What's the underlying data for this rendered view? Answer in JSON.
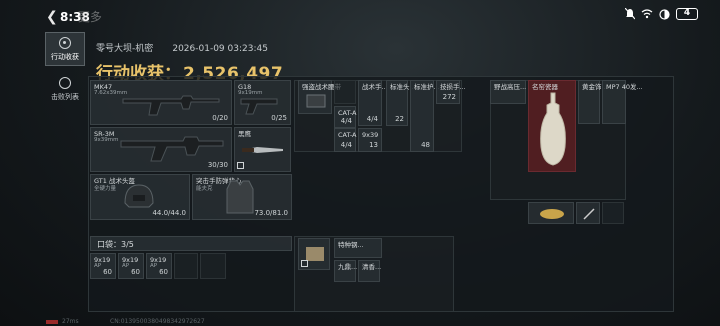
{
  "status_bar": {
    "time": "8:38",
    "back_label": "更多",
    "battery": "4"
  },
  "nav": {
    "items": [
      {
        "label": "行动收获",
        "icon": "target-icon",
        "active": true
      },
      {
        "label": "击败列表",
        "icon": "skull-icon",
        "active": false
      }
    ]
  },
  "header": {
    "map": "零号大坝-机密",
    "date": "2026-01-09 03:23:45",
    "loot_label": "行动收获：",
    "loot_value": "2,526,497"
  },
  "weapons": [
    {
      "name": "MK47",
      "sub": "7.62x39mm",
      "count": "0/20"
    },
    {
      "name": "G18",
      "sub": "9x19mm",
      "count": "0/25"
    },
    {
      "name": "SR-3M",
      "sub": "9x39mm",
      "count": "30/30"
    },
    {
      "name": "黑鹰",
      "sub": "",
      "count": ""
    }
  ],
  "gear": [
    {
      "name": "GT1 战术头盔",
      "sub": "全硬力量",
      "durability": "44.0/44.0"
    },
    {
      "name": "突击手防弹背心",
      "sub": "能夫克",
      "durability": "73.0/81.0"
    }
  ],
  "pouch": {
    "label": "口袋：3/5",
    "items": [
      {
        "name": "9x19",
        "sub": "AP",
        "count": "60"
      },
      {
        "name": "9x19",
        "sub": "AP",
        "count": "60"
      },
      {
        "name": "9x19",
        "sub": "AP",
        "count": "60"
      }
    ]
  },
  "rig": {
    "items": [
      {
        "name": "强盗战术腰带"
      },
      {
        "name": "战术手...",
        "count": "4/4"
      },
      {
        "name": "标准头...",
        "count": "22"
      },
      {
        "name": "标准护...",
        "count": "48"
      },
      {
        "name": "技损手...",
        "count": "272"
      },
      {
        "name": "CAT-A",
        "count": "4/4"
      },
      {
        "name": "CAT-A",
        "count": "4/4"
      },
      {
        "name": "9x39",
        "count": "13"
      }
    ]
  },
  "backpack_items": [
    {
      "name": "特种钢..."
    },
    {
      "name": "九鼎..."
    },
    {
      "name": "清香..."
    }
  ],
  "safe_box": {
    "items": [
      {
        "name": "野战高压..."
      },
      {
        "name": "名窑瓷器"
      },
      {
        "name": "黄金饰..."
      },
      {
        "name": "MP7 40发..."
      }
    ]
  },
  "footer": {
    "ping": "27ms",
    "cn": "CN:0139500380498342972627"
  }
}
